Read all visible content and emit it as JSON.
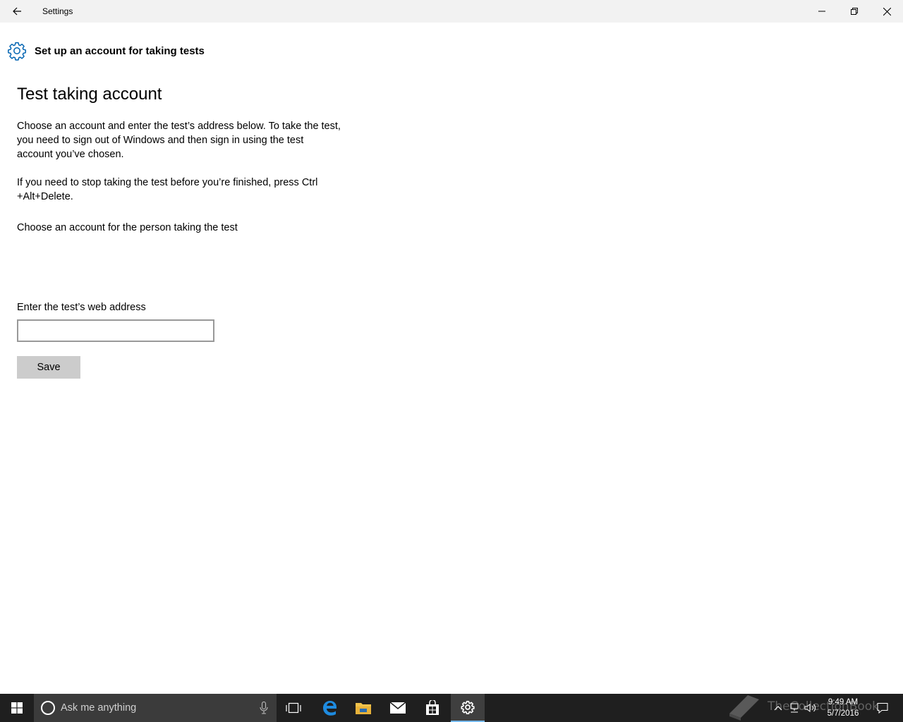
{
  "window": {
    "title": "Settings",
    "back_icon": "arrow-left-icon",
    "minimize_icon": "minimize-icon",
    "restore_icon": "restore-icon",
    "close_icon": "close-icon"
  },
  "header": {
    "icon": "gear-icon",
    "title": "Set up an account for taking tests"
  },
  "content": {
    "section_title": "Test taking account",
    "paragraph1": "Choose an account and enter the test’s address below. To take the test, you need to sign out of Windows and then sign in using the test account you’ve chosen.",
    "paragraph2": "If you need to stop taking the test before you’re finished, press Ctrl +Alt+Delete.",
    "choose_account_label": "Choose an account for the person taking the test",
    "web_address_label": "Enter the test’s web address",
    "web_address_value": "",
    "save_label": "Save"
  },
  "taskbar": {
    "search_placeholder": "Ask me anything",
    "apps": [
      "windows-start-icon",
      "task-view-icon",
      "edge-icon",
      "file-explorer-icon",
      "mail-icon",
      "store-icon",
      "settings-icon"
    ],
    "active_app": "settings-icon",
    "time": "9:49 AM",
    "date": "5/7/2016",
    "watermark": "TheCollectionBook",
    "accent_color": "#0063b1"
  }
}
